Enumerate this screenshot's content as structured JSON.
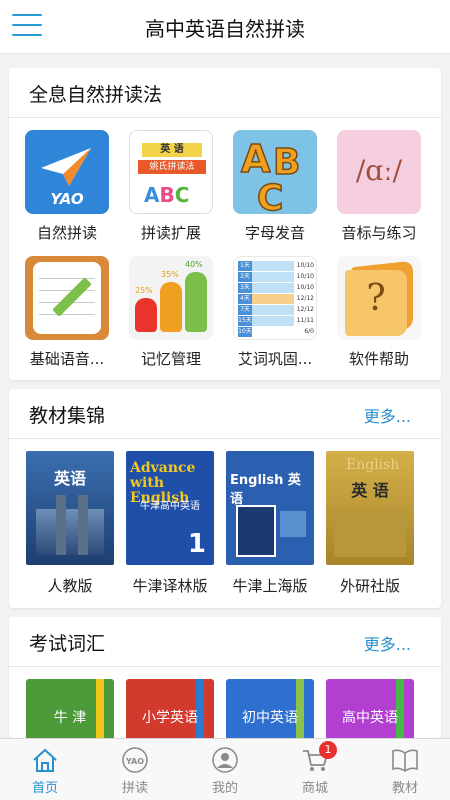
{
  "header": {
    "title": "高中英语自然拼读"
  },
  "phonics": {
    "title": "全息自然拼读法",
    "items": [
      {
        "label": "自然拼读",
        "icon": "yao-plane-icon",
        "logo_text": "YAO"
      },
      {
        "label": "拼读扩展",
        "icon": "book-cover-icon",
        "art_top": "英 语",
        "art_mid": "姚氏拼读法"
      },
      {
        "label": "字母发音",
        "icon": "abc-letters-icon",
        "art": "ABC"
      },
      {
        "label": "音标与练习",
        "icon": "phonetic-icon",
        "art": "/ɑː/"
      },
      {
        "label": "基础语音...",
        "icon": "notepad-pencil-icon"
      },
      {
        "label": "记忆管理",
        "icon": "bar-chart-icon",
        "art_pcts": [
          "25%",
          "35%",
          "40%"
        ]
      },
      {
        "label": "艾词巩固...",
        "icon": "progress-list-icon",
        "art_rows": [
          "10/10",
          "10/10",
          "10/10",
          "12/12",
          "12/12",
          "11/11",
          "6/0"
        ],
        "art_days": [
          "1天",
          "2天",
          "3天",
          "4天",
          "7天",
          "15天",
          "10天"
        ]
      },
      {
        "label": "软件帮助",
        "icon": "help-book-icon",
        "art": "?"
      }
    ]
  },
  "textbooks": {
    "title": "教材集锦",
    "more": "更多...",
    "items": [
      {
        "label": "人教版",
        "cover_text": "英语",
        "color": "#2f5f9c"
      },
      {
        "label": "牛津译林版",
        "cover_text": "Advance with English",
        "sub": "牛津高中英语",
        "num": "1",
        "color": "#1f4fa8"
      },
      {
        "label": "牛津上海版",
        "cover_text": "English 英语",
        "color": "#2b5fb0"
      },
      {
        "label": "外研社版",
        "cover_text": "英 语",
        "cover_en": "English",
        "color": "#c9a33a"
      }
    ]
  },
  "vocab": {
    "title": "考试词汇",
    "more": "更多...",
    "items": [
      {
        "label": "牛 津",
        "color": "#4c9a3a",
        "ribbon": "#f0c419"
      },
      {
        "label": "小学英语",
        "color": "#d23a2e",
        "ribbon": "#2a7ad0"
      },
      {
        "label": "初中英语",
        "color": "#2f6fd0",
        "ribbon": "#8bc34a"
      },
      {
        "label": "高中英语",
        "color": "#b23fd0",
        "ribbon": "#48b848"
      }
    ]
  },
  "tabs": [
    {
      "label": "首页",
      "icon": "home-icon",
      "active": true
    },
    {
      "label": "拼读",
      "icon": "yao-logo-icon",
      "art": "YAO"
    },
    {
      "label": "我的",
      "icon": "user-icon"
    },
    {
      "label": "商城",
      "icon": "cart-icon",
      "badge": "1"
    },
    {
      "label": "教材",
      "icon": "open-book-icon"
    }
  ],
  "colors": {
    "accent": "#2a8fd0",
    "badge": "#e8322f"
  }
}
